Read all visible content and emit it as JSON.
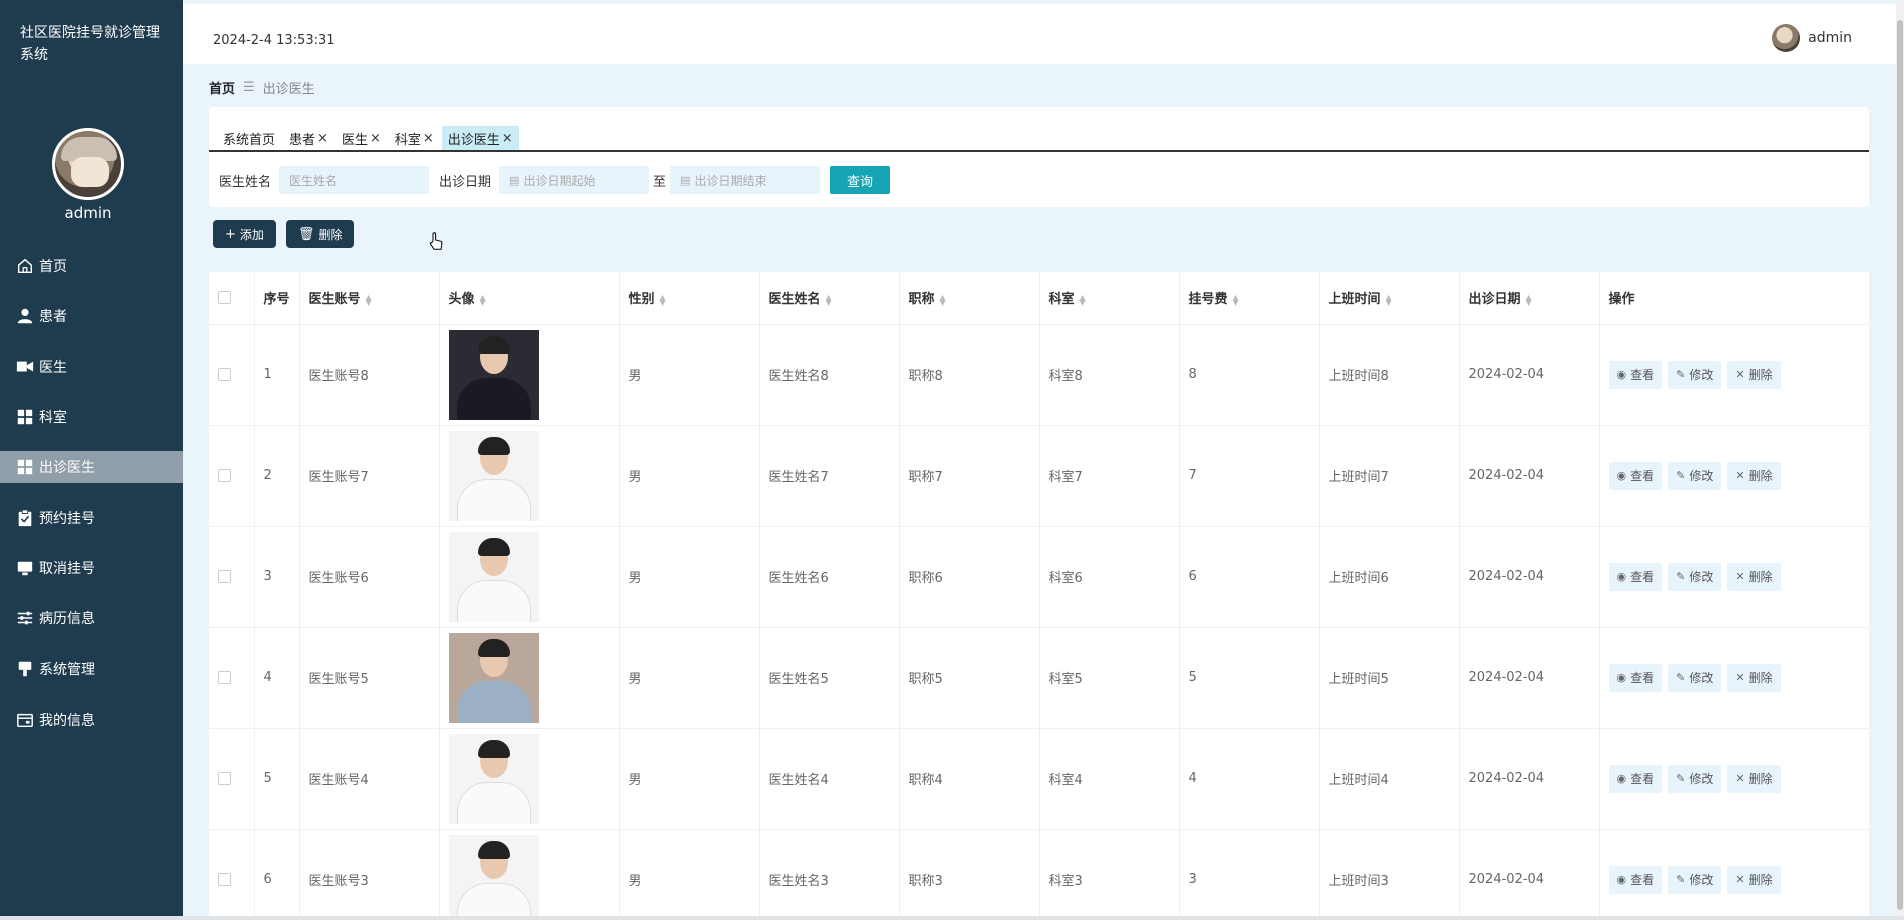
{
  "app": {
    "title": "社区医院挂号就诊管理系统"
  },
  "sidebar": {
    "user_name": "admin",
    "items": [
      {
        "label": "首页",
        "icon": "home-icon"
      },
      {
        "label": "患者",
        "icon": "person-icon"
      },
      {
        "label": "医生",
        "icon": "doctor-icon"
      },
      {
        "label": "科室",
        "icon": "grid-icon"
      },
      {
        "label": "出诊医生",
        "icon": "grid-icon",
        "active": true
      },
      {
        "label": "预约挂号",
        "icon": "clipboard-icon"
      },
      {
        "label": "取消挂号",
        "icon": "monitor-icon"
      },
      {
        "label": "病历信息",
        "icon": "sliders-icon"
      },
      {
        "label": "系统管理",
        "icon": "stamp-icon"
      },
      {
        "label": "我的信息",
        "icon": "card-icon"
      }
    ]
  },
  "topbar": {
    "datetime": "2024-2-4 13:53:31",
    "user": "admin"
  },
  "breadcrumb": {
    "home": "首页",
    "separator": "☰",
    "current": "出诊医生"
  },
  "tabs": [
    {
      "label": "系统首页",
      "closable": false
    },
    {
      "label": "患者",
      "closable": true
    },
    {
      "label": "医生",
      "closable": true
    },
    {
      "label": "科室",
      "closable": true
    },
    {
      "label": "出诊医生",
      "closable": true,
      "active": true
    }
  ],
  "tab_close_glyph": "×",
  "search": {
    "name_label": "医生姓名",
    "name_placeholder": "医生姓名",
    "date_label": "出诊日期",
    "date_start_placeholder": "出诊日期起始",
    "date_to": "至",
    "date_end_placeholder": "出诊日期结束",
    "query_button": "查询"
  },
  "actions": {
    "add": "添加",
    "delete": "删除",
    "add_icon": "+",
    "delete_icon": "🗑"
  },
  "table": {
    "columns": [
      "序号",
      "医生账号",
      "头像",
      "性别",
      "医生姓名",
      "职称",
      "科室",
      "挂号费",
      "上班时间",
      "出诊日期",
      "操作"
    ],
    "rows": [
      {
        "no": "1",
        "account": "医生账号8",
        "gender": "男",
        "name": "医生姓名8",
        "title": "职称8",
        "dept": "科室8",
        "fee": "8",
        "shift": "上班时间8",
        "date": "2024-02-04"
      },
      {
        "no": "2",
        "account": "医生账号7",
        "gender": "男",
        "name": "医生姓名7",
        "title": "职称7",
        "dept": "科室7",
        "fee": "7",
        "shift": "上班时间7",
        "date": "2024-02-04"
      },
      {
        "no": "3",
        "account": "医生账号6",
        "gender": "男",
        "name": "医生姓名6",
        "title": "职称6",
        "dept": "科室6",
        "fee": "6",
        "shift": "上班时间6",
        "date": "2024-02-04"
      },
      {
        "no": "4",
        "account": "医生账号5",
        "gender": "男",
        "name": "医生姓名5",
        "title": "职称5",
        "dept": "科室5",
        "fee": "5",
        "shift": "上班时间5",
        "date": "2024-02-04"
      },
      {
        "no": "5",
        "account": "医生账号4",
        "gender": "男",
        "name": "医生姓名4",
        "title": "职称4",
        "dept": "科室4",
        "fee": "4",
        "shift": "上班时间4",
        "date": "2024-02-04"
      },
      {
        "no": "6",
        "account": "医生账号3",
        "gender": "男",
        "name": "医生姓名3",
        "title": "职称3",
        "dept": "科室3",
        "fee": "3",
        "shift": "上班时间3",
        "date": "2024-02-04"
      }
    ],
    "row_actions": {
      "view": "查看",
      "edit": "修改",
      "delete": "删除"
    }
  },
  "colors": {
    "sidebar_bg": "#1f3c4f",
    "accent": "#17a5b5",
    "active_tab": "#c9ecf6",
    "page_bg": "#eaf4fb"
  }
}
